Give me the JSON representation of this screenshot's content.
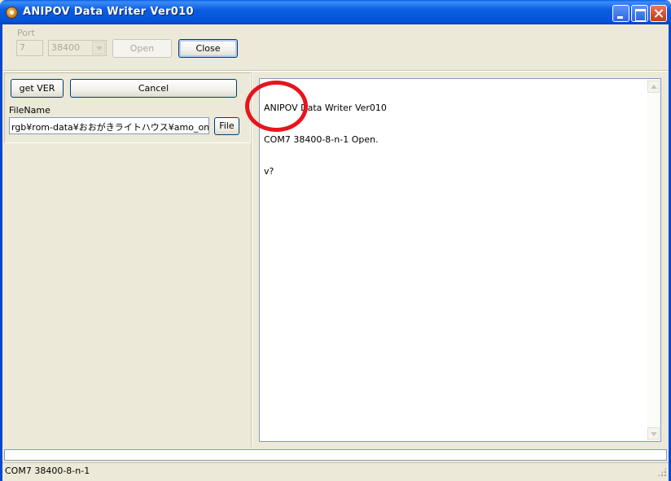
{
  "window": {
    "title": "ANIPOV Data Writer Ver010",
    "icon": "app-gear-icon"
  },
  "port": {
    "label": "Port",
    "number": "7",
    "baud_rate": "38400",
    "open_label": "Open",
    "close_label": "Close"
  },
  "left_panel": {
    "get_ver_label": "get VER",
    "cancel_label": "Cancel",
    "filename_label": "FileName",
    "filename_value": "rgb¥rom-data¥おおがきライトハウス¥amo_only.csv",
    "file_button_label": "File"
  },
  "log": {
    "lines": [
      "ANIPOV Data Writer Ver010",
      "COM7 38400-8-n-1 Open.",
      "v?"
    ]
  },
  "progress": {
    "fraction": 0
  },
  "status": {
    "text": "COM7 38400-8-n-1"
  },
  "colors": {
    "titlebar": "#0a5ee0",
    "face": "#ece9d8",
    "annotation": "#e8141c"
  }
}
